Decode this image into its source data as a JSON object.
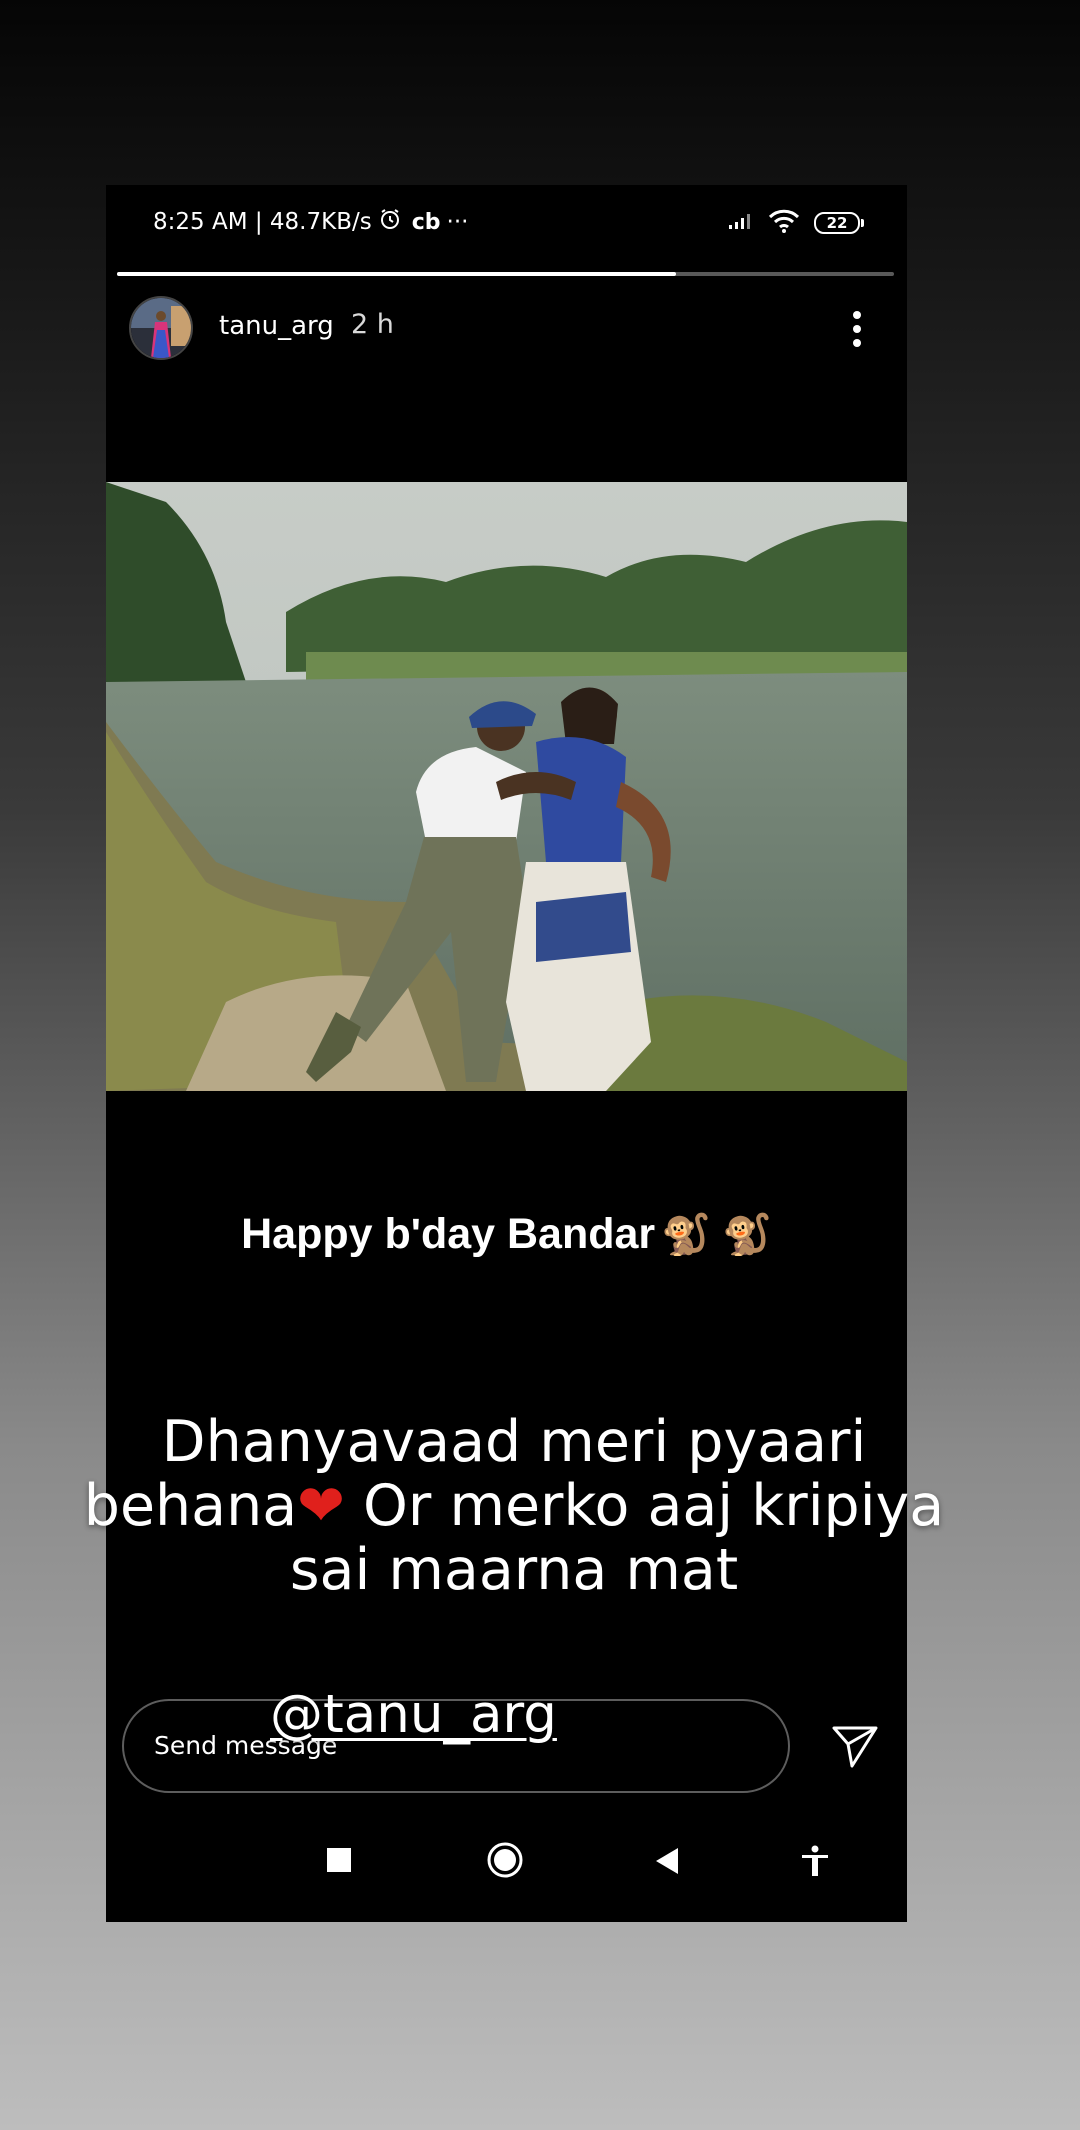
{
  "status_bar": {
    "time_speed": "8:25 AM | 48.7KB/s",
    "app_badge": "cb",
    "overflow": "···",
    "battery": "22"
  },
  "story": {
    "progress_fraction": 0.72,
    "username": "tanu_arg",
    "time_ago": "2 h",
    "caption": "Happy b'day Bandar",
    "caption_emoji": "🐒 🐒",
    "reply_line1": "Dhanyavaad meri pyaari",
    "reply_line2a": "behana",
    "reply_heart": "❤",
    "reply_line2b": " Or merko aaj kripiya",
    "reply_line3": "sai maarna mat",
    "mention": "@tanu_arg"
  },
  "message_bar": {
    "placeholder": "Send message"
  },
  "colors": {
    "heart": "#e0201c",
    "background_top": "#050505",
    "background_bottom": "#bdbdbd"
  },
  "icons": [
    "alarm-icon",
    "signal-icon",
    "wifi-icon",
    "battery-icon",
    "more-vertical-icon",
    "send-icon",
    "recents-icon",
    "home-icon",
    "back-icon",
    "accessibility-icon"
  ]
}
